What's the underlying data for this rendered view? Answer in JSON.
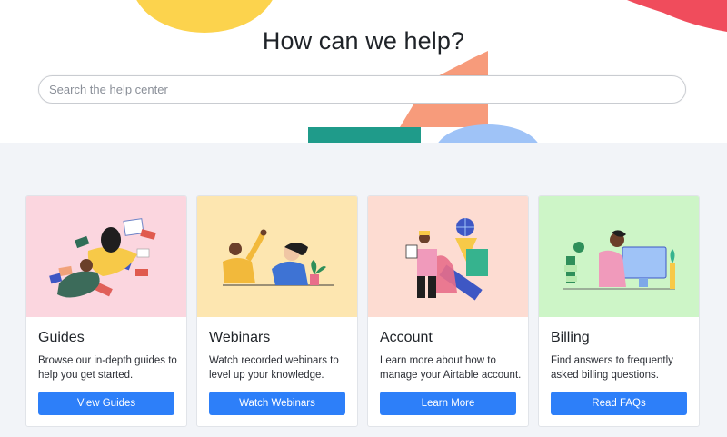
{
  "hero": {
    "title": "How can we help?",
    "search_placeholder": "Search the help center"
  },
  "cards": [
    {
      "title": "Guides",
      "description": "Browse our in-depth guides to help you get started.",
      "button": "View Guides",
      "bg": "#fbd6df"
    },
    {
      "title": "Webinars",
      "description": "Watch recorded webinars to level up your knowledge.",
      "button": "Watch Webinars",
      "bg": "#fde6b0"
    },
    {
      "title": "Account",
      "description": "Learn more about how to manage your Airtable account.",
      "button": "Learn More",
      "bg": "#fddcd2"
    },
    {
      "title": "Billing",
      "description": "Find answers to frequently asked billing questions.",
      "button": "Read FAQs",
      "bg": "#cdf5c7"
    }
  ],
  "colors": {
    "accent": "#2d7ff9",
    "page_background": "#f2f4f8"
  }
}
